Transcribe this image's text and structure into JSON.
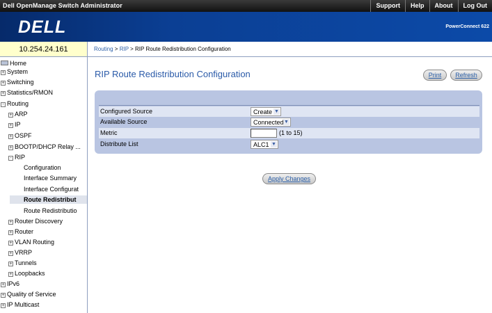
{
  "topbar": {
    "app_title": "Dell OpenManage Switch Administrator",
    "links": [
      "Support",
      "Help",
      "About",
      "Log Out"
    ]
  },
  "banner": {
    "logo_text": "DELL",
    "product": "PowerConnect 622"
  },
  "device": {
    "ip": "10.254.24.161"
  },
  "breadcrumb": {
    "items": [
      "Routing",
      "RIP",
      "RIP Route Redistribution Configuration"
    ],
    "separator": " > "
  },
  "sidebar": {
    "items": [
      {
        "label": "Home",
        "toggle": ""
      },
      {
        "label": "System",
        "toggle": "+"
      },
      {
        "label": "Switching",
        "toggle": "+"
      },
      {
        "label": "Statistics/RMON",
        "toggle": "+"
      },
      {
        "label": "Routing",
        "toggle": "-"
      },
      {
        "label": "ARP",
        "toggle": "+"
      },
      {
        "label": "IP",
        "toggle": "+"
      },
      {
        "label": "OSPF",
        "toggle": "+"
      },
      {
        "label": "BOOTP/DHCP Relay ...",
        "toggle": "+"
      },
      {
        "label": "RIP",
        "toggle": "-"
      },
      {
        "label": "Configuration",
        "toggle": ""
      },
      {
        "label": "Interface Summary",
        "toggle": ""
      },
      {
        "label": "Interface Configurat",
        "toggle": ""
      },
      {
        "label": "Route Redistribut",
        "toggle": ""
      },
      {
        "label": "Route Redistributio",
        "toggle": ""
      },
      {
        "label": "Router Discovery",
        "toggle": "+"
      },
      {
        "label": "Router",
        "toggle": "+"
      },
      {
        "label": "VLAN Routing",
        "toggle": "+"
      },
      {
        "label": "VRRP",
        "toggle": "+"
      },
      {
        "label": "Tunnels",
        "toggle": "+"
      },
      {
        "label": "Loopbacks",
        "toggle": "+"
      },
      {
        "label": "IPv6",
        "toggle": "+"
      },
      {
        "label": "Quality of Service",
        "toggle": "+"
      },
      {
        "label": "IP Multicast",
        "toggle": "+"
      }
    ]
  },
  "page": {
    "title": "RIP Route Redistribution Configuration",
    "print_label": "Print",
    "refresh_label": "Refresh",
    "apply_label": "Apply Changes"
  },
  "form": {
    "configured_source": {
      "label": "Configured Source",
      "value": "Create"
    },
    "available_source": {
      "label": "Available Source",
      "value": "Connected"
    },
    "metric": {
      "label": "Metric",
      "value": "",
      "hint": "(1 to 15)"
    },
    "distribute_list": {
      "label": "Distribute List",
      "value": "ALC1"
    }
  },
  "colors": {
    "accent": "#2a5aa8",
    "banner": "#0b3f94",
    "panel": "#b9c5e2",
    "ip_box": "#ffffcc"
  }
}
